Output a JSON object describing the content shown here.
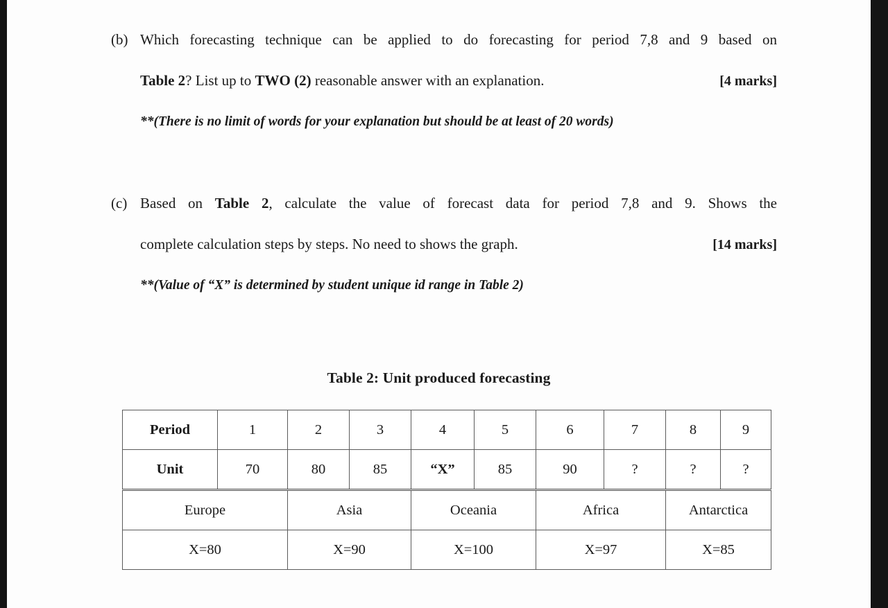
{
  "document": {
    "questions": [
      {
        "marker": "(b)",
        "line1": "Which forecasting technique can be applied to do forecasting for period 7,8 and 9 based on",
        "line2_pre": "Table 2",
        "line2_mid": "? List up to ",
        "line2_bold": "TWO (2)",
        "line2_post": " reasonable answer with an explanation.",
        "marks": "[4 marks]",
        "note": "**(There is no limit of words for your explanation but should be at least of 20 words)"
      },
      {
        "marker": "(c)",
        "line1_pre": "Based on ",
        "line1_bold": "Table 2",
        "line1_post": ", calculate the value of forecast data for period 7,8 and 9. Shows the",
        "line2": "complete calculation steps by steps. No need to shows the graph.",
        "marks": "[14 marks]",
        "note": "**(Value of “X” is determined by student unique id range in Table 2)"
      }
    ],
    "table": {
      "caption": "Table 2: Unit produced forecasting",
      "rows": {
        "period_label": "Period",
        "periods": [
          "1",
          "2",
          "3",
          "4",
          "5",
          "6",
          "7",
          "8",
          "9"
        ],
        "unit_label": "Unit",
        "units": [
          "70",
          "80",
          "85",
          "“X”",
          "85",
          "90",
          "?",
          "?",
          "?"
        ],
        "regions": [
          "Europe",
          "Asia",
          "Oceania",
          "Africa",
          "Antarctica"
        ],
        "region_values": [
          "X=80",
          "X=90",
          "X=100",
          "X=97",
          "X=85"
        ]
      }
    }
  }
}
